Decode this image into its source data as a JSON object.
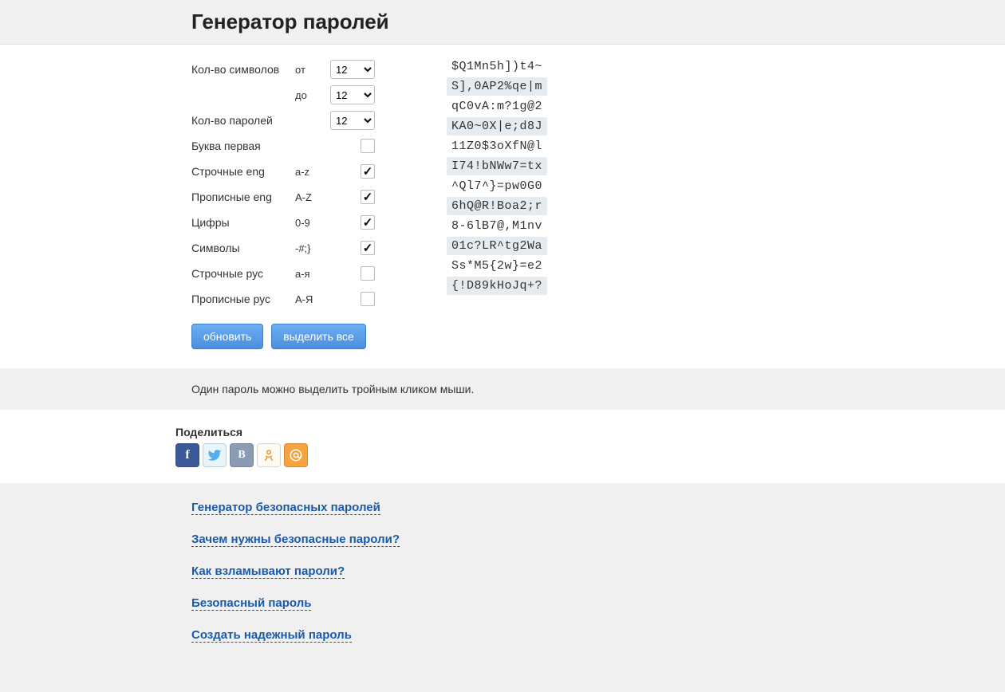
{
  "title": "Генератор паролей",
  "form": {
    "chars_label": "Кол-во символов",
    "from_label": "от",
    "to_label": "до",
    "from_value": "12",
    "to_value": "12",
    "count_label": "Кол-во паролей",
    "count_value": "12",
    "first_letter_label": "Буква первая",
    "lower_eng_label": "Строчные eng",
    "lower_eng_hint": "a-z",
    "upper_eng_label": "Прописные eng",
    "upper_eng_hint": "A-Z",
    "digits_label": "Цифры",
    "digits_hint": "0-9",
    "symbols_label": "Символы",
    "symbols_hint": "-#;}",
    "lower_rus_label": "Строчные рус",
    "lower_rus_hint": "а-я",
    "upper_rus_label": "Прописные рус",
    "upper_rus_hint": "А-Я",
    "checks": {
      "first_letter": false,
      "lower_eng": true,
      "upper_eng": true,
      "digits": true,
      "symbols": true,
      "lower_rus": false,
      "upper_rus": false
    }
  },
  "buttons": {
    "refresh": "обновить",
    "select_all": "выделить все"
  },
  "passwords": [
    "$Q1Mn5h])t4~",
    "S],0AP2%qe|m",
    "qC0vA:m?1g@2",
    "KA0~0X|e;d8J",
    "11Z0$3oXfN@l",
    "I74!bNWw7=tx",
    "^Ql7^}=pw0G0",
    "6hQ@R!Boa2;r",
    "8-6lB7@,M1nv",
    "01c?LR^tg2Wa",
    "Ss*M5{2w}=e2",
    "{!D89kHoJq+?"
  ],
  "hint": "Один пароль можно выделить тройным кликом мыши.",
  "share_title": "Поделиться",
  "links": [
    "Генератор безопасных паролей",
    "Зачем нужны безопасные пароли?",
    "Как взламывают пароли?",
    "Безопасный пароль",
    "Создать надежный пароль"
  ]
}
